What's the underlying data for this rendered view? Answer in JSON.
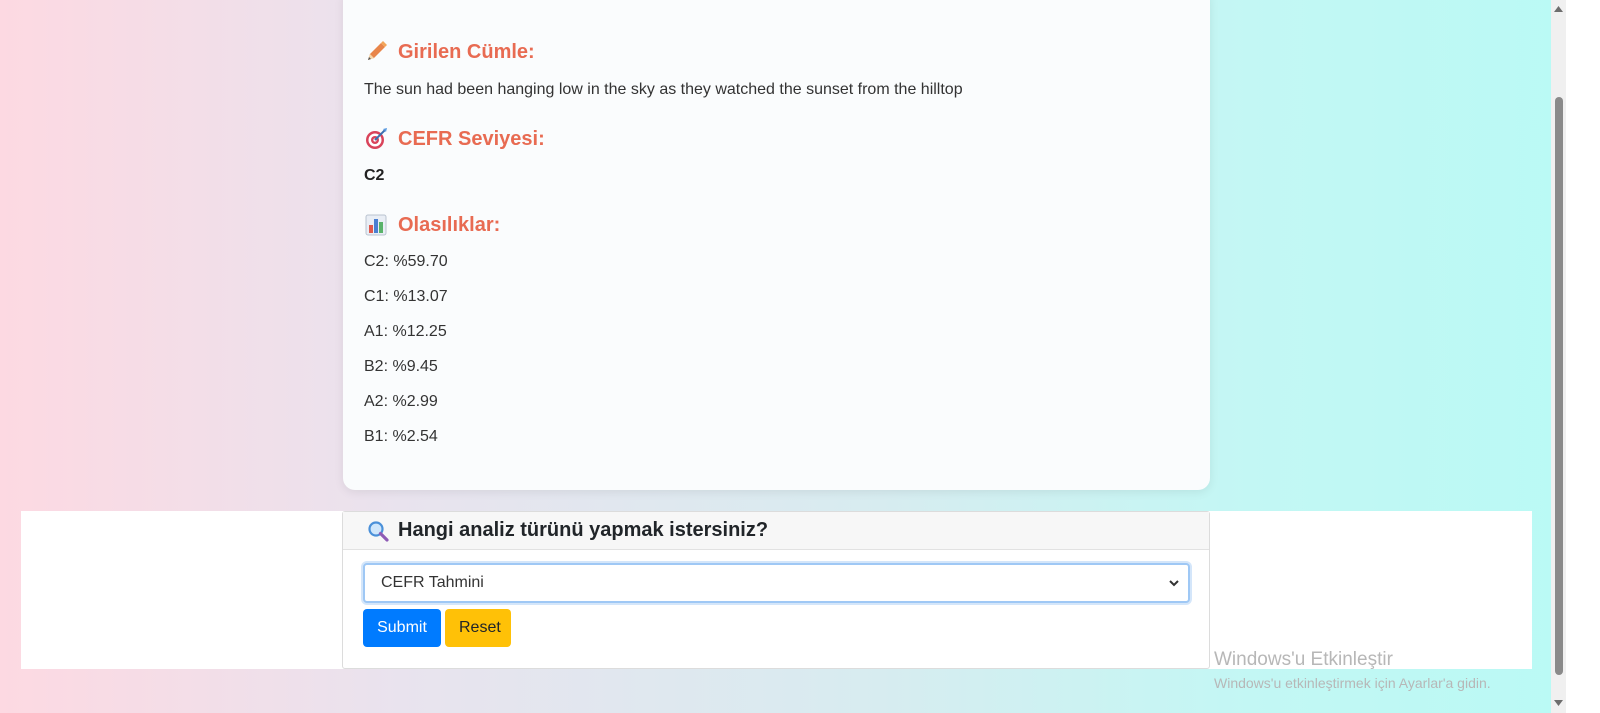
{
  "result": {
    "sentence_heading": "Girilen Cümle:",
    "sentence": "The sun had been hanging low in the sky as they watched the sunset from the hilltop",
    "level_heading": "CEFR Seviyesi:",
    "level": "C2",
    "prob_heading": "Olasılıklar:",
    "probabilities": [
      {
        "text": "C2: %59.70"
      },
      {
        "text": "C1: %13.07"
      },
      {
        "text": "A1: %12.25"
      },
      {
        "text": "B2: %9.45"
      },
      {
        "text": "A2: %2.99"
      },
      {
        "text": "B1: %2.54"
      }
    ]
  },
  "form": {
    "title": "Hangi analiz türünü yapmak istersiniz?",
    "select_value": "CEFR Tahmini",
    "submit_label": "Submit",
    "reset_label": "Reset"
  },
  "watermark": {
    "title": "Windows'u Etkinleştir",
    "subtitle": "Windows'u etkinleştirmek için Ayarlar'a gidin."
  },
  "icons": {
    "sentence": "pencil-icon",
    "level": "target-icon",
    "probabilities": "bar-chart-icon",
    "form": "magnifier-icon",
    "select": "chevron-down-icon"
  },
  "colors": {
    "heading": "#e86b52",
    "submit": "#007bff",
    "reset": "#ffc107"
  }
}
